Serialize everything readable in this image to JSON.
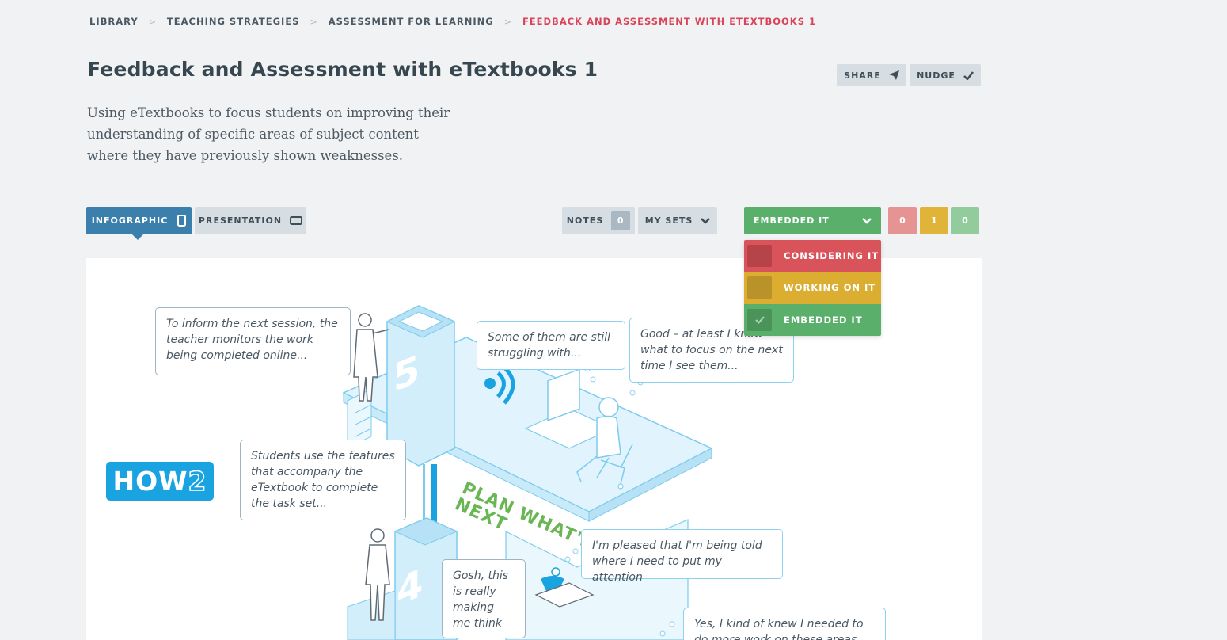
{
  "breadcrumb": {
    "items": [
      "LIBRARY",
      "TEACHING STRATEGIES",
      "ASSESSMENT FOR LEARNING"
    ],
    "current": "FEEDBACK AND ASSESSMENT WITH ETEXTBOOKS 1",
    "separator": ">"
  },
  "page": {
    "title": "Feedback and Assessment with eTextbooks 1",
    "description": "Using eTextbooks to focus students on improving their understanding of specific areas of subject content where they have previously shown weaknesses."
  },
  "actions": {
    "share_label": "SHARE",
    "nudge_label": "NUDGE"
  },
  "tabs": {
    "infographic_label": "INFOGRAPHIC",
    "presentation_label": "PRESENTATION"
  },
  "toolbar": {
    "notes_label": "NOTES",
    "notes_count": "0",
    "mysets_label": "MY SETS",
    "status_selected": "EMBEDDED IT"
  },
  "counts": {
    "considering": "0",
    "working": "1",
    "embedded": "0"
  },
  "status_options": [
    {
      "label": "CONSIDERING IT"
    },
    {
      "label": "WORKING ON IT"
    },
    {
      "label": "EMBEDDED IT"
    }
  ],
  "infographic": {
    "logo_text": "HOW",
    "logo_number": "2",
    "step_5": "5",
    "step_4": "4",
    "plan_text_line1": "PLAN WHAT'S",
    "plan_text_line2": "NEXT",
    "bubbles": {
      "teacher_monitor": "To inform the next session, the teacher monitors the work being completed online...",
      "students_use": "Students use the features that accompany the eTextbook to complete the task set...",
      "still_struggling": "Some of them are still struggling with...",
      "good_focus": "Good – at least I know what to focus on the next time I see them...",
      "pleased": "I'm pleased that I'm being told where I need to put my attention",
      "gosh": "Gosh, this is really making me think",
      "yes_knew": "Yes, I kind of knew I needed to do more work on these areas"
    }
  },
  "colors": {
    "accent_blue": "#3b7fad",
    "breadcrumb_current": "#d9445a",
    "considering": "#d9535a",
    "working": "#dbae32",
    "embedded": "#5aaf6b",
    "logo_blue": "#19a3e1",
    "plan_green": "#6ab655"
  },
  "icons": {
    "share": "paper-plane-icon",
    "nudge": "check-icon",
    "infographic": "tablet-portrait-icon",
    "presentation": "tablet-landscape-icon",
    "mysets": "chevron-down-icon",
    "status": "chevron-down-icon",
    "embedded_check": "check-icon"
  }
}
